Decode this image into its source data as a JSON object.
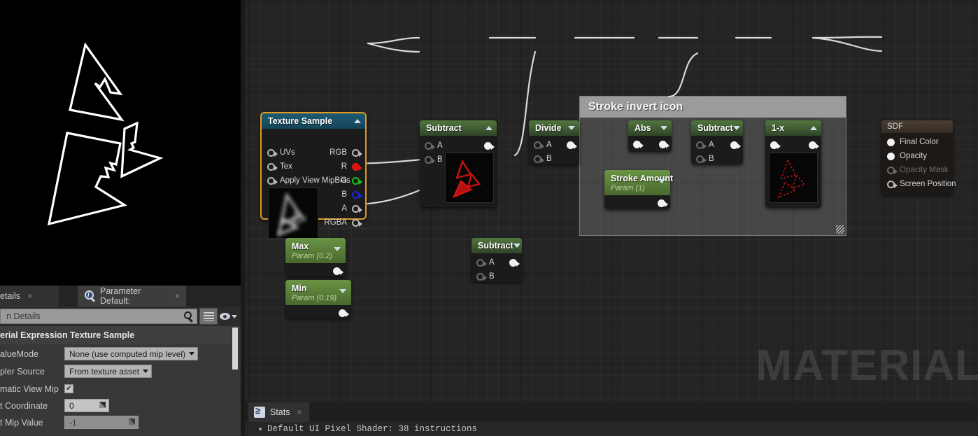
{
  "preview": {
    "name": "material-preview-viewport",
    "background": "#000000",
    "shape_color": "#ffffff",
    "description": "Three white outlined triangles"
  },
  "details": {
    "tabs": [
      {
        "label": "etails",
        "active": false,
        "close": "×",
        "icon": ""
      },
      {
        "label": "Parameter Default:",
        "active": true,
        "close": "×",
        "icon": "info-magnifier-icon"
      }
    ],
    "search_placeholder": "n Details",
    "search_value": "",
    "section_title": "erial Expression Texture Sample",
    "rows": [
      {
        "label": "alueMode",
        "type": "combo",
        "value": "None (use computed mip level)"
      },
      {
        "label": "pler Source",
        "type": "combo",
        "value": "From texture asset"
      },
      {
        "label": "matic View Mip Bi",
        "type": "checkbox",
        "value": "checked"
      },
      {
        "label": "t Coordinate",
        "type": "number",
        "value": "0",
        "dim": false
      },
      {
        "label": "t Mip Value",
        "type": "number",
        "value": "-1",
        "dim": true
      }
    ]
  },
  "graph": {
    "watermark": "MATERIAL",
    "comment": {
      "title": "Stroke invert icon"
    },
    "nodes": {
      "texture_sample": {
        "title": "Texture Sample",
        "collapse": "up",
        "selected": true,
        "inputs": [
          {
            "label": "UVs",
            "color": "white"
          },
          {
            "label": "Tex",
            "color": "white"
          },
          {
            "label": "Apply View MipBias",
            "color": "white"
          }
        ],
        "outputs": [
          {
            "label": "RGB",
            "color": "white"
          },
          {
            "label": "R",
            "color": "red"
          },
          {
            "label": "G",
            "color": "green"
          },
          {
            "label": "B",
            "color": "blue"
          },
          {
            "label": "A",
            "color": "white"
          },
          {
            "label": "RGBA",
            "color": "white"
          }
        ]
      },
      "subtract_1": {
        "title": "Subtract",
        "collapse": "up",
        "inputs": [
          {
            "label": "A"
          },
          {
            "label": "B"
          }
        ],
        "outputs": [
          {
            "label": ""
          }
        ],
        "preview": "red-triangles"
      },
      "divide": {
        "title": "Divide",
        "collapse": "down",
        "inputs": [
          {
            "label": "A"
          },
          {
            "label": "B"
          }
        ],
        "outputs": [
          {
            "label": ""
          }
        ]
      },
      "abs": {
        "title": "Abs",
        "collapse": "down",
        "inputs": [
          {
            "label": ""
          }
        ],
        "outputs": [
          {
            "label": ""
          }
        ]
      },
      "subtract_2": {
        "title": "Subtract",
        "collapse": "down",
        "inputs": [
          {
            "label": "A"
          },
          {
            "label": "B"
          }
        ],
        "outputs": [
          {
            "label": ""
          }
        ]
      },
      "one_minus_x": {
        "title": "1-x",
        "collapse": "up",
        "inputs": [
          {
            "label": ""
          }
        ],
        "outputs": [
          {
            "label": ""
          }
        ],
        "preview": "red-dashed-triangles"
      },
      "stroke_amount": {
        "title": "Stroke Amount",
        "subtitle": "Param (1)",
        "collapse": "down",
        "outputs": [
          {
            "label": ""
          }
        ]
      },
      "max_param": {
        "title": "Max",
        "subtitle": "Param (0.2)",
        "collapse": "down",
        "outputs": [
          {
            "label": ""
          }
        ]
      },
      "min_param": {
        "title": "Min",
        "subtitle": "Param (0.19)",
        "collapse": "down",
        "outputs": [
          {
            "label": ""
          }
        ]
      },
      "subtract_3": {
        "title": "Subtract",
        "collapse": "down",
        "inputs": [
          {
            "label": "A"
          },
          {
            "label": "B"
          }
        ],
        "outputs": [
          {
            "label": ""
          }
        ]
      },
      "sdf_output": {
        "title": "SDF",
        "inputs": [
          {
            "label": "Final Color",
            "state": "connected"
          },
          {
            "label": "Opacity",
            "state": "connected"
          },
          {
            "label": "Opacity Mask",
            "state": "disabled"
          },
          {
            "label": "Screen Position",
            "state": "empty"
          }
        ]
      }
    },
    "colors": {
      "node_header_teal": "#1d5a72",
      "node_header_green": "#51763f",
      "node_header_param": "#6a9444",
      "node_header_output": "#4a3f34",
      "selection": "#e39a22",
      "wire": "#d8d8d8",
      "pin_red": "#e01414",
      "pin_green": "#14c014",
      "pin_blue": "#1a28d8"
    }
  },
  "stats": {
    "tab_label": "Stats",
    "tab_close": "×",
    "line": "Default UI Pixel Shader: 38 instructions"
  }
}
